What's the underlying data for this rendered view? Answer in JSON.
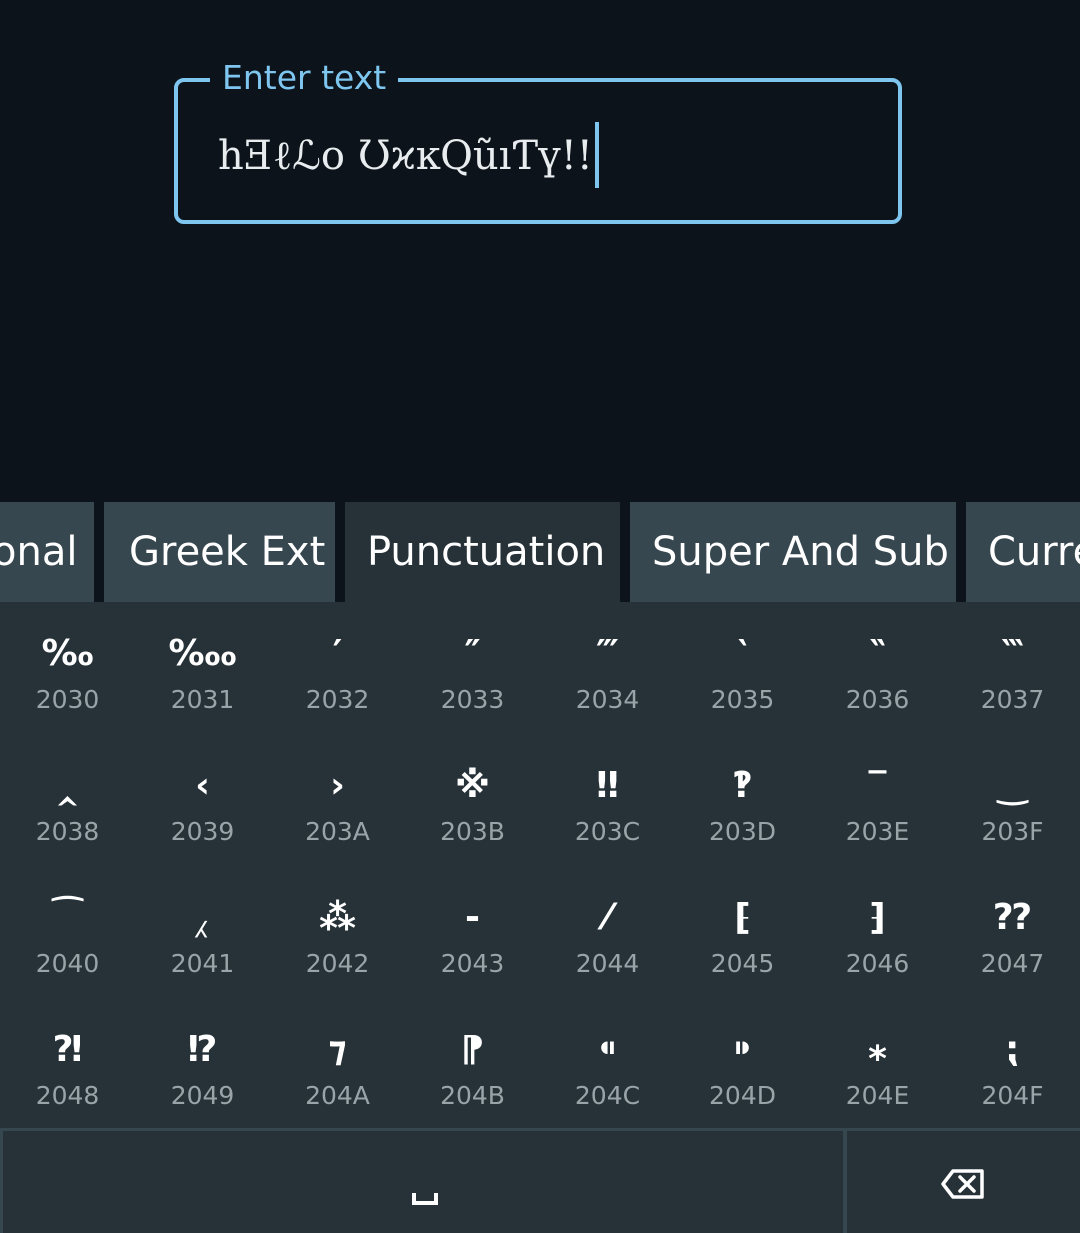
{
  "text_field": {
    "label": "Enter text",
    "value": "hƎℓℒo ƱϰĸQũıƬү!!"
  },
  "tabs": [
    {
      "label": "onal",
      "active": false
    },
    {
      "label": "Greek Ext",
      "active": false
    },
    {
      "label": "Punctuation",
      "active": true
    },
    {
      "label": "Super And Sub",
      "active": false
    },
    {
      "label": "Curre",
      "active": false
    }
  ],
  "keys": [
    {
      "glyph": "‰",
      "code": "2030"
    },
    {
      "glyph": "‱",
      "code": "2031"
    },
    {
      "glyph": "′",
      "code": "2032"
    },
    {
      "glyph": "″",
      "code": "2033"
    },
    {
      "glyph": "‴",
      "code": "2034"
    },
    {
      "glyph": "‵",
      "code": "2035"
    },
    {
      "glyph": "‶",
      "code": "2036"
    },
    {
      "glyph": "‷",
      "code": "2037"
    },
    {
      "glyph": "‸",
      "code": "2038"
    },
    {
      "glyph": "‹",
      "code": "2039"
    },
    {
      "glyph": "›",
      "code": "203A"
    },
    {
      "glyph": "※",
      "code": "203B"
    },
    {
      "glyph": "‼",
      "code": "203C"
    },
    {
      "glyph": "‽",
      "code": "203D"
    },
    {
      "glyph": "‾",
      "code": "203E"
    },
    {
      "glyph": "‿",
      "code": "203F"
    },
    {
      "glyph": "⁀",
      "code": "2040"
    },
    {
      "glyph": "⁁",
      "code": "2041"
    },
    {
      "glyph": "⁂",
      "code": "2042"
    },
    {
      "glyph": "⁃",
      "code": "2043"
    },
    {
      "glyph": "⁄",
      "code": "2044"
    },
    {
      "glyph": "⁅",
      "code": "2045"
    },
    {
      "glyph": "⁆",
      "code": "2046"
    },
    {
      "glyph": "⁇",
      "code": "2047"
    },
    {
      "glyph": "⁈",
      "code": "2048"
    },
    {
      "glyph": "⁉",
      "code": "2049"
    },
    {
      "glyph": "⁊",
      "code": "204A"
    },
    {
      "glyph": "⁋",
      "code": "204B"
    },
    {
      "glyph": "⁌",
      "code": "204C"
    },
    {
      "glyph": "⁍",
      "code": "204D"
    },
    {
      "glyph": "⁎",
      "code": "204E"
    },
    {
      "glyph": "⁏",
      "code": "204F"
    }
  ],
  "bottom_bar": {
    "space_icon": "space-bar-icon",
    "backspace_icon": "backspace-icon"
  },
  "colors": {
    "background": "#0c131a",
    "accent": "#7ec6ef",
    "keyboard": "#263238",
    "tab": "#37474f",
    "code_text": "#9aa3a8"
  }
}
